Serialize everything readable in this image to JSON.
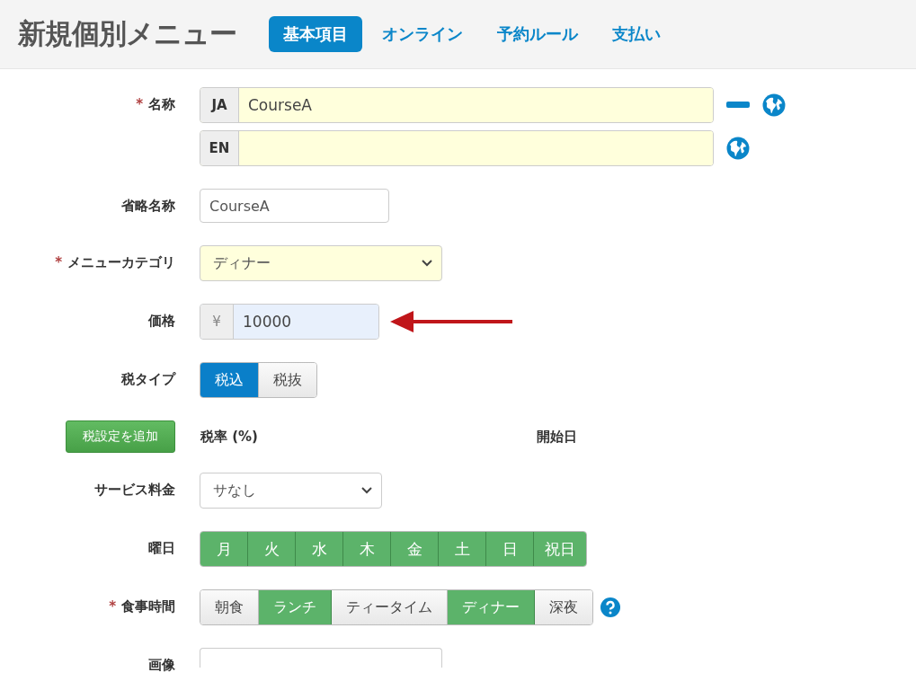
{
  "header": {
    "title": "新規個別メニュー",
    "tabs": [
      {
        "label": "基本項目",
        "selected": true
      },
      {
        "label": "オンライン",
        "selected": false
      },
      {
        "label": "予約ルール",
        "selected": false
      },
      {
        "label": "支払い",
        "selected": false
      }
    ]
  },
  "fields": [
    {
      "kind": "multilang",
      "label": "名称",
      "mark": "*",
      "rows": [
        {
          "lang": "JA",
          "value": "CourseA",
          "removable": true
        },
        {
          "lang": "EN",
          "removable": false
        }
      ]
    },
    {
      "kind": "text",
      "label": "省略名称",
      "value": "CourseA"
    },
    {
      "kind": "select",
      "label": "メニューカテゴリ",
      "mark": "*",
      "value": "ディナー"
    },
    {
      "kind": "price",
      "label": "価格",
      "prefix": "¥",
      "value": "10000",
      "focused": true
    },
    {
      "kind": "toggle",
      "label": "税タイプ",
      "options": [
        {
          "label": "税込",
          "selected": true
        },
        {
          "label": "税抜",
          "selected": false
        }
      ]
    },
    {
      "kind": "tax",
      "button": "税設定を追加",
      "columns": [
        "税率 (%)",
        "開始日"
      ]
    },
    {
      "kind": "select",
      "label": "サービス料金",
      "value": "サなし"
    },
    {
      "kind": "days",
      "label": "曜日",
      "options": [
        {
          "label": "月",
          "selected": true
        },
        {
          "label": "火",
          "selected": true
        },
        {
          "label": "水",
          "selected": true
        },
        {
          "label": "木",
          "selected": true
        },
        {
          "label": "金",
          "selected": true
        },
        {
          "label": "土",
          "selected": true
        },
        {
          "label": "日",
          "selected": true
        },
        {
          "label": "祝日",
          "selected": true
        }
      ]
    },
    {
      "kind": "meal",
      "label": "食事時間",
      "mark": "*",
      "help": true,
      "options": [
        {
          "label": "朝食",
          "selected": false
        },
        {
          "label": "ランチ",
          "selected": true
        },
        {
          "label": "ティータイム",
          "selected": false
        },
        {
          "label": "ディナー",
          "selected": true
        },
        {
          "label": "深夜",
          "selected": false
        }
      ]
    },
    {
      "kind": "image",
      "label": "画像"
    }
  ]
}
